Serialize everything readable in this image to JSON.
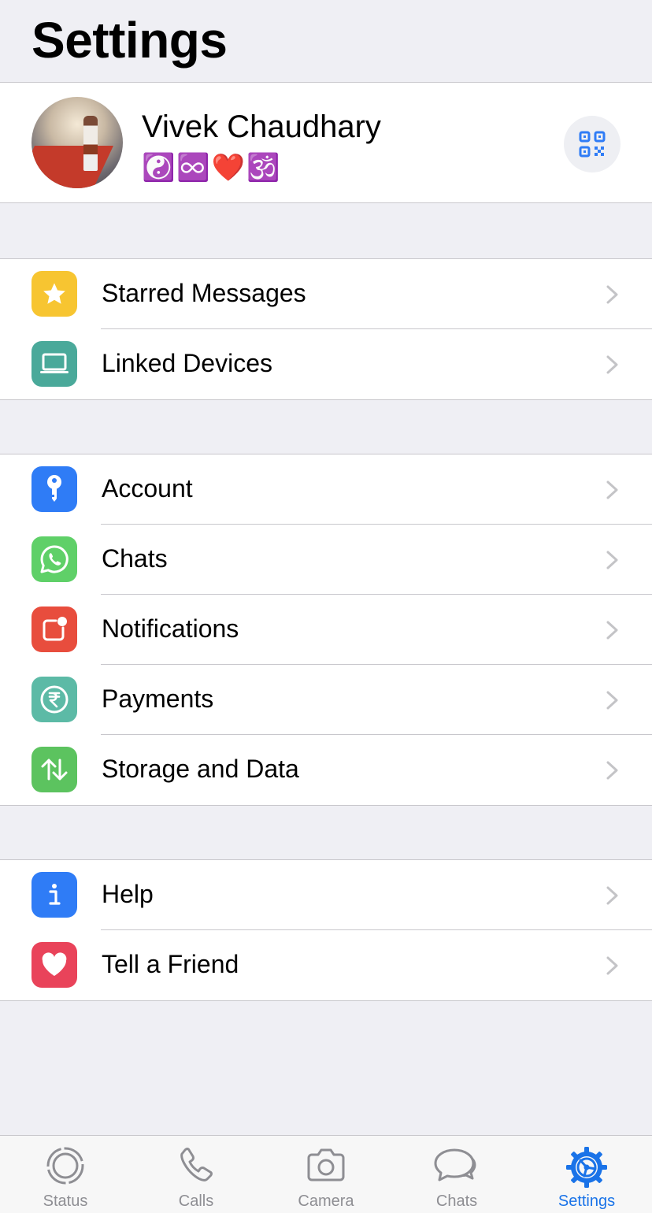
{
  "header": {
    "title": "Settings"
  },
  "profile": {
    "name": "Vivek Chaudhary",
    "status": "☯️♾️❤️🕉️"
  },
  "groups": [
    {
      "items": [
        {
          "label": "Starred Messages",
          "icon": "star-icon",
          "color": "#f7c531"
        },
        {
          "label": "Linked Devices",
          "icon": "laptop-icon",
          "color": "#4aa99a"
        }
      ]
    },
    {
      "items": [
        {
          "label": "Account",
          "icon": "key-icon",
          "color": "#2f7cf6"
        },
        {
          "label": "Chats",
          "icon": "whatsapp-icon",
          "color": "#5fd068"
        },
        {
          "label": "Notifications",
          "icon": "notification-badge-icon",
          "color": "#e84d3d"
        },
        {
          "label": "Payments",
          "icon": "rupee-icon",
          "color": "#5cbaa6"
        },
        {
          "label": "Storage and Data",
          "icon": "up-down-arrows-icon",
          "color": "#5cc35f"
        }
      ]
    },
    {
      "items": [
        {
          "label": "Help",
          "icon": "info-icon",
          "color": "#2f7cf6"
        },
        {
          "label": "Tell a Friend",
          "icon": "heart-icon",
          "color": "#e9435a"
        }
      ]
    }
  ],
  "tabbar": {
    "tabs": [
      {
        "label": "Status",
        "icon": "status-icon"
      },
      {
        "label": "Calls",
        "icon": "phone-icon"
      },
      {
        "label": "Camera",
        "icon": "camera-icon"
      },
      {
        "label": "Chats",
        "icon": "chat-bubbles-icon"
      },
      {
        "label": "Settings",
        "icon": "gear-icon",
        "active": true
      }
    ],
    "active_color": "#1a73e8",
    "inactive_color": "#8e8e93"
  }
}
